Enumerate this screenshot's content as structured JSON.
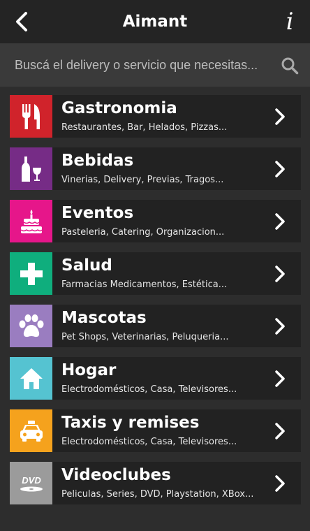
{
  "header": {
    "title": "Aimant",
    "back_icon": "chevron-left-icon",
    "info_label": "i"
  },
  "search": {
    "placeholder": "Buscá el delivery o servicio que necesitas...",
    "value": "",
    "icon": "search-icon"
  },
  "colors": {
    "background": "#2d2d2d",
    "header": "#242424",
    "search_bar": "#3a3a3a",
    "row": "#222222"
  },
  "categories": [
    {
      "title": "Gastronomia",
      "subtitle": "Restaurantes, Bar, Helados, Pizzas...",
      "icon": "fork-knife-icon",
      "color": "#d0232b"
    },
    {
      "title": "Bebidas",
      "subtitle": "Vinerias, Delivery, Previas, Tragos...",
      "icon": "wine-bottle-glass-icon",
      "color": "#762c86"
    },
    {
      "title": "Eventos",
      "subtitle": "Pasteleria, Catering, Organizacion...",
      "icon": "birthday-cake-icon",
      "color": "#e6168a"
    },
    {
      "title": "Salud",
      "subtitle": "Farmacias Medicamentos, Estética...",
      "icon": "health-cross-icon",
      "color": "#0fae7d"
    },
    {
      "title": "Mascotas",
      "subtitle": "Pet Shops, Veterinarias, Peluqueria...",
      "icon": "paw-icon",
      "color": "#9a7dc0"
    },
    {
      "title": "Hogar",
      "subtitle": "Electrodomésticos, Casa, Televisores...",
      "icon": "house-icon",
      "color": "#55c3d1"
    },
    {
      "title": "Taxis y remises",
      "subtitle": "Electrodomésticos, Casa, Televisores...",
      "icon": "taxi-icon",
      "color": "#f5a21d"
    },
    {
      "title": "Videoclubes",
      "subtitle": "Peliculas, Series, DVD, Playstation, XBox...",
      "icon": "dvd-icon",
      "color": "#9b9b9b",
      "icon_text": "DVD"
    }
  ]
}
